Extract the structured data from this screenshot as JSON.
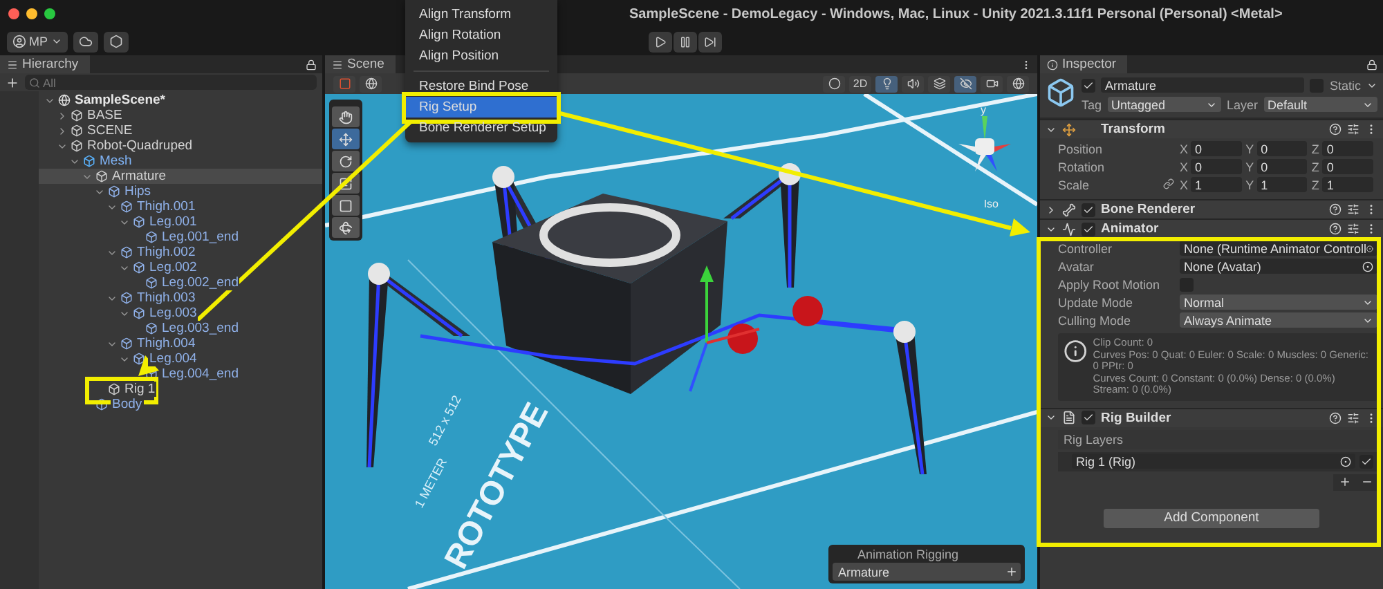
{
  "window": {
    "title": "SampleScene - DemoLegacy - Windows, Mac, Linux - Unity 2021.3.11f1 Personal (Personal) <Metal>"
  },
  "toolbar": {
    "account": "MP"
  },
  "hierarchy": {
    "title": "Hierarchy",
    "search": {
      "placeholder": "All"
    },
    "tree": [
      {
        "label": "SampleScene*",
        "kind": "scene",
        "expanded": true,
        "selected": false,
        "children": [
          {
            "label": "BASE",
            "kind": "object",
            "expanded": false,
            "selected": false
          },
          {
            "label": "SCENE",
            "kind": "object",
            "expanded": false,
            "selected": false
          },
          {
            "label": "Robot-Quadruped",
            "kind": "object",
            "expanded": true,
            "selected": false,
            "children": [
              {
                "label": "Mesh",
                "kind": "prefab",
                "expanded": true,
                "selected": false,
                "children": [
                  {
                    "label": "Armature",
                    "kind": "object",
                    "expanded": true,
                    "selected": true,
                    "children": [
                      {
                        "label": "Hips",
                        "kind": "part",
                        "expanded": true,
                        "selected": false,
                        "children": [
                          {
                            "label": "Thigh.001",
                            "kind": "part",
                            "expanded": true,
                            "selected": false,
                            "children": [
                              {
                                "label": "Leg.001",
                                "kind": "part",
                                "expanded": true,
                                "selected": false,
                                "children": [
                                  {
                                    "label": "Leg.001_end",
                                    "kind": "part",
                                    "selected": false
                                  }
                                ]
                              }
                            ]
                          },
                          {
                            "label": "Thigh.002",
                            "kind": "part",
                            "expanded": true,
                            "selected": false,
                            "children": [
                              {
                                "label": "Leg.002",
                                "kind": "part",
                                "expanded": true,
                                "selected": false,
                                "children": [
                                  {
                                    "label": "Leg.002_end",
                                    "kind": "part",
                                    "selected": false
                                  }
                                ]
                              }
                            ]
                          },
                          {
                            "label": "Thigh.003",
                            "kind": "part",
                            "expanded": true,
                            "selected": false,
                            "children": [
                              {
                                "label": "Leg.003",
                                "kind": "part",
                                "expanded": true,
                                "selected": false,
                                "children": [
                                  {
                                    "label": "Leg.003_end",
                                    "kind": "part",
                                    "selected": false
                                  }
                                ]
                              }
                            ]
                          },
                          {
                            "label": "Thigh.004",
                            "kind": "part",
                            "expanded": true,
                            "selected": false,
                            "children": [
                              {
                                "label": "Leg.004",
                                "kind": "part",
                                "expanded": true,
                                "selected": false,
                                "children": [
                                  {
                                    "label": "Leg.004_end",
                                    "kind": "part",
                                    "selected": false
                                  }
                                ]
                              }
                            ]
                          }
                        ]
                      },
                      {
                        "label": "Rig 1",
                        "kind": "rig",
                        "selected": false
                      }
                    ]
                  },
                  {
                    "label": "Body",
                    "kind": "part",
                    "selected": false
                  }
                ]
              }
            ]
          }
        ]
      }
    ]
  },
  "scene": {
    "title": "Scene",
    "toolbar": [
      {
        "kind": "shading",
        "on": false
      },
      {
        "kind": "flat",
        "label": "2D",
        "on": false
      },
      {
        "kind": "lighting",
        "on": true
      },
      {
        "kind": "audio",
        "on": false
      },
      {
        "kind": "effects",
        "on": false
      },
      {
        "kind": "visibility",
        "on": true
      },
      {
        "kind": "camera",
        "on": false
      },
      {
        "kind": "gizmos",
        "on": false
      }
    ],
    "tools": [
      {
        "kind": "hand",
        "selected": false
      },
      {
        "kind": "move",
        "selected": true
      },
      {
        "kind": "rotate",
        "selected": false
      },
      {
        "kind": "scale",
        "selected": false
      },
      {
        "kind": "rect",
        "selected": false
      },
      {
        "kind": "transform",
        "selected": false
      }
    ],
    "ground_texts": [
      "ROTOTYPE",
      "1 METER",
      "512 x 512"
    ],
    "gizmo": {
      "axis": "y",
      "projection": "Iso"
    },
    "overlay": {
      "title": "Animation Rigging",
      "value": "Armature"
    }
  },
  "menu": {
    "groups": [
      [
        {
          "label": "Align Transform",
          "selected": false
        },
        {
          "label": "Align Rotation",
          "selected": false
        },
        {
          "label": "Align Position",
          "selected": false
        }
      ],
      [
        {
          "label": "Restore Bind Pose",
          "selected": false
        },
        {
          "label": "Rig Setup",
          "selected": true
        },
        {
          "label": "Bone Renderer Setup",
          "selected": false
        }
      ]
    ]
  },
  "inspector": {
    "title": "Inspector",
    "object": {
      "name": "Armature",
      "active": true,
      "static_label": "Static",
      "static": false,
      "tag_label": "Tag",
      "tag": "Untagged",
      "layer_label": "Layer",
      "layer": "Default"
    },
    "components": [
      {
        "name": "Transform",
        "kind": "transform",
        "expanded": true,
        "rows": [
          {
            "label": "Position",
            "values": [
              {
                "axis": "X",
                "value": "0"
              },
              {
                "axis": "Y",
                "value": "0"
              },
              {
                "axis": "Z",
                "value": "0"
              }
            ]
          },
          {
            "label": "Rotation",
            "values": [
              {
                "axis": "X",
                "value": "0"
              },
              {
                "axis": "Y",
                "value": "0"
              },
              {
                "axis": "Z",
                "value": "0"
              }
            ]
          },
          {
            "label": "Scale",
            "linked": true,
            "values": [
              {
                "axis": "X",
                "value": "1"
              },
              {
                "axis": "Y",
                "value": "1"
              },
              {
                "axis": "Z",
                "value": "1"
              }
            ]
          }
        ]
      },
      {
        "name": "Bone Renderer",
        "kind": "bone_renderer",
        "expanded": false,
        "enabled": true
      },
      {
        "name": "Animator",
        "kind": "animator",
        "expanded": true,
        "enabled": true,
        "fields": [
          {
            "label": "Controller",
            "kind": "object",
            "value": "None (Runtime Animator Controll"
          },
          {
            "label": "Avatar",
            "kind": "object",
            "value": "None (Avatar)"
          },
          {
            "label": "Apply Root Motion",
            "kind": "checkbox",
            "checked": false
          },
          {
            "label": "Update Mode",
            "kind": "dropdown",
            "value": "Normal"
          },
          {
            "label": "Culling Mode",
            "kind": "dropdown",
            "value": "Always Animate"
          }
        ],
        "info": [
          "Clip Count: 0",
          "Curves Pos: 0 Quat: 0 Euler: 0 Scale: 0 Muscles: 0 Generic: 0 PPtr: 0",
          "Curves Count: 0 Constant: 0 (0.0%) Dense: 0 (0.0%) Stream: 0 (0.0%)"
        ]
      },
      {
        "name": "Rig Builder",
        "kind": "rig_builder",
        "expanded": true,
        "enabled": true,
        "list_title": "Rig Layers",
        "layers": [
          {
            "name": "Rig 1 (Rig)",
            "active": true
          }
        ]
      }
    ],
    "add_component": "Add Component"
  }
}
